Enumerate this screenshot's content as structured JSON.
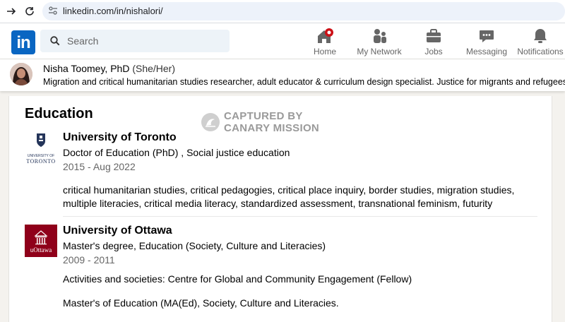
{
  "browser": {
    "url": "linkedin.com/in/nishalori/"
  },
  "header": {
    "logo_text": "in",
    "search_placeholder": "Search",
    "nav": [
      {
        "label": "Home",
        "icon": "home-icon"
      },
      {
        "label": "My Network",
        "icon": "network-icon"
      },
      {
        "label": "Jobs",
        "icon": "briefcase-icon"
      },
      {
        "label": "Messaging",
        "icon": "messaging-icon"
      },
      {
        "label": "Notifications",
        "icon": "bell-icon"
      }
    ]
  },
  "profile": {
    "name": "Nisha Toomey, PhD",
    "pronouns": "(She/Her)",
    "headline": "Migration and critical humanitarian studies researcher, adult educator & curriculum design specialist. Justice for migrants and refugees now!"
  },
  "watermark": {
    "line1": "CAPTURED BY",
    "line2": "CANARY MISSION"
  },
  "education": {
    "title": "Education",
    "entries": [
      {
        "logo_text": "TORONTO",
        "logo_small": "UNIVERSITY OF",
        "school": "University of Toronto",
        "degree": "Doctor of Education (PhD) , Social justice education",
        "dates": "2015 - Aug 2022",
        "description": "critical humanitarian studies, critical pedagogies, critical place inquiry, border studies, migration studies, multiple literacies, critical media literacy, standardized assessment, transnational feminism, futurity"
      },
      {
        "logo_text": "uOttawa",
        "school": "University of Ottawa",
        "degree": "Master's degree, Education (Society, Culture and Literacies)",
        "dates": "2009 - 2011",
        "activities": "Activities and societies: Centre for Global and Community Engagement (Fellow)",
        "description": "Master's of Education (MA(Ed), Society, Culture and Literacies."
      }
    ]
  },
  "colors": {
    "linkedin_blue": "#0a66c2",
    "uottawa_red": "#8f001a",
    "notification_red": "#cc1016"
  }
}
